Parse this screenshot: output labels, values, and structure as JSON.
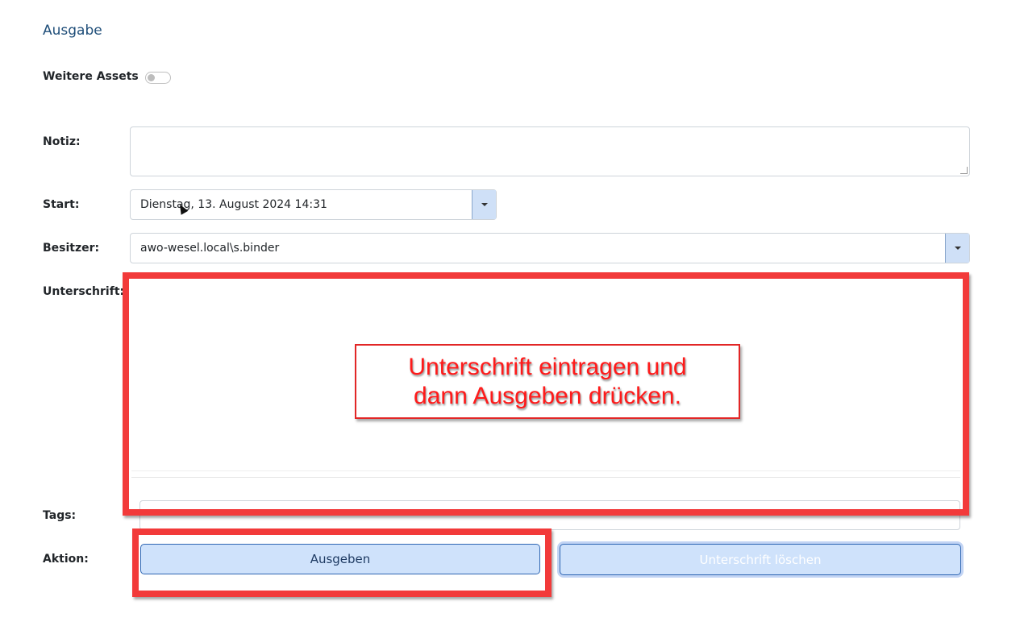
{
  "page": {
    "title": "Ausgabe"
  },
  "toggle": {
    "label": "Weitere Assets",
    "on": false
  },
  "form": {
    "notiz_label": "Notiz:",
    "notiz_value": "",
    "start_label": "Start:",
    "start_value": "Dienstag, 13. August 2024 14:31",
    "besitzer_label": "Besitzer:",
    "besitzer_value": "awo-wesel.local\\s.binder",
    "unterschrift_label": "Unterschrift:",
    "tags_label": "Tags:",
    "tags_value": "",
    "aktion_label": "Aktion:"
  },
  "buttons": {
    "ausgeben": "Ausgeben",
    "unterschrift_loeschen": "Unterschrift löschen"
  },
  "annotation": {
    "line1": "Unterschrift eintragen und",
    "line2": "dann Ausgeben drücken."
  },
  "colors": {
    "accent": "#1f4e79",
    "highlight_red": "#f23a3a",
    "button_bg": "#cfe2fb"
  }
}
